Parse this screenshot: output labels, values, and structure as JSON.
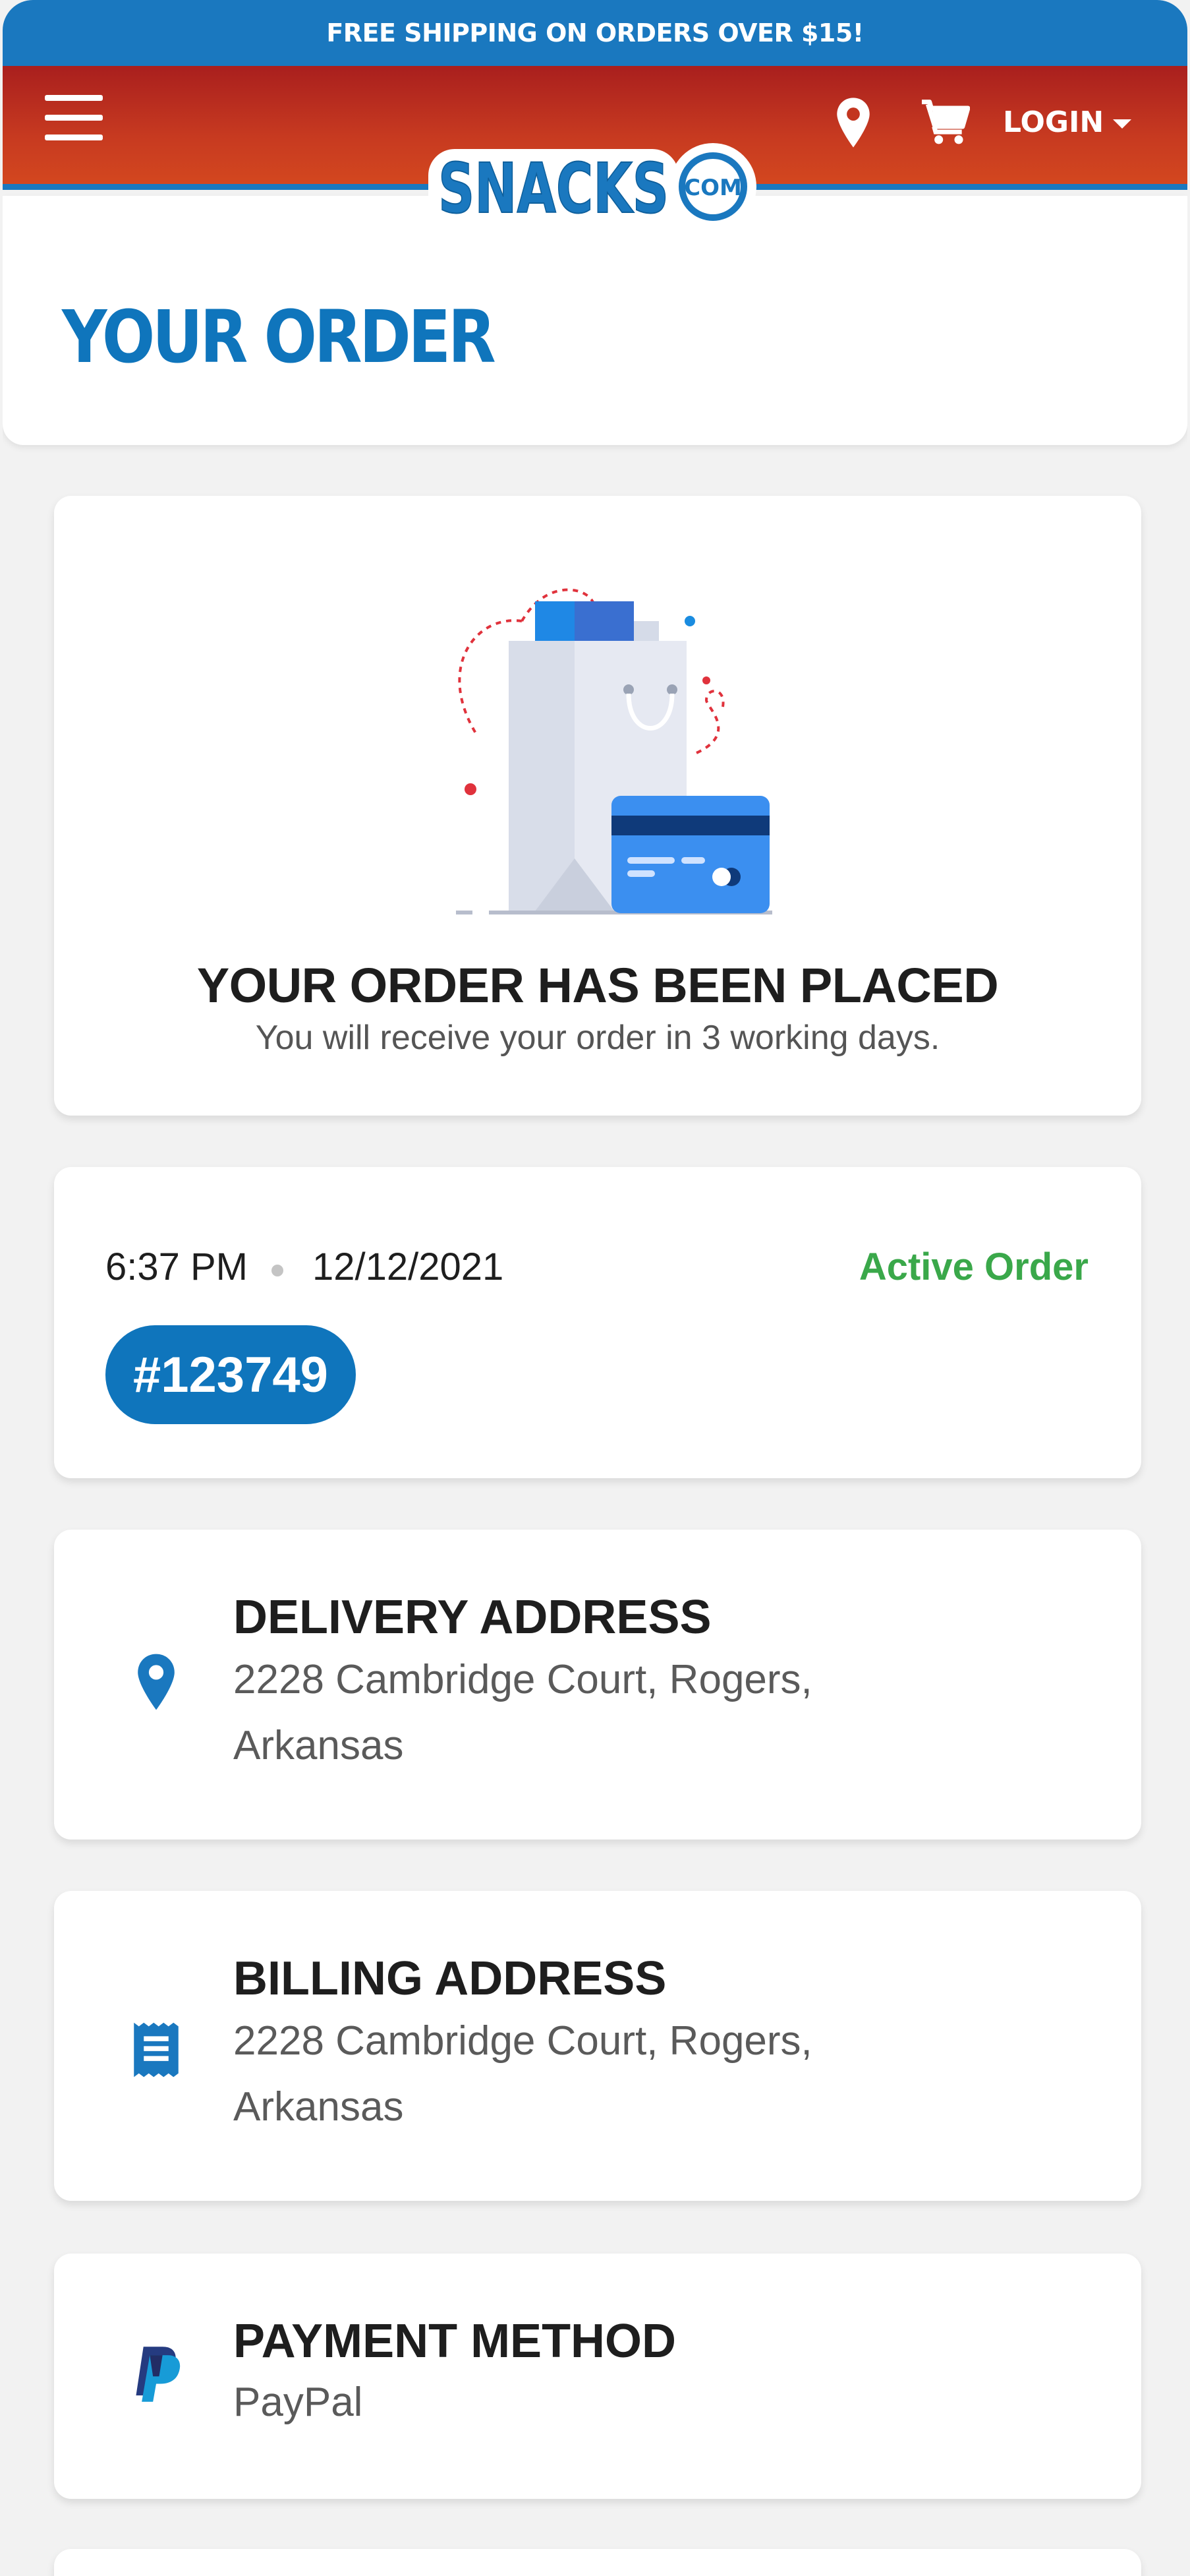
{
  "promo": {
    "text": "FREE SHIPPING ON ORDERS OVER $15!"
  },
  "header": {
    "menu_icon": "hamburger-menu-icon",
    "location_icon": "map-pin-icon",
    "cart_icon": "shopping-cart-icon",
    "login_label": "LOGIN",
    "logo_text": "SNACKS",
    "logo_badge": "COM",
    "colors": {
      "header_red": "#c73a20",
      "brand_blue": "#0f75bc"
    }
  },
  "page": {
    "title": "YOUR ORDER"
  },
  "placed": {
    "title": "YOUR ORDER HAS BEEN PLACED",
    "subtitle": "You will receive your order in 3 working days.",
    "illustration": "shopping-bag-and-credit-card-icon"
  },
  "order": {
    "time": "6:37 PM",
    "date": "12/12/2021",
    "status": "Active Order",
    "number": "#123749",
    "status_color": "#3aa84a"
  },
  "delivery": {
    "title": "DELIVERY ADDRESS",
    "address_line1": "2228 Cambridge Court, Rogers,",
    "address_line2": "Arkansas",
    "icon": "map-pin-icon"
  },
  "billing": {
    "title": "BILLING ADDRESS",
    "address_line1": "2228 Cambridge Court, Rogers,",
    "address_line2": "Arkansas",
    "icon": "receipt-icon"
  },
  "payment": {
    "title": "PAYMENT METHOD",
    "method": "PayPal",
    "icon": "paypal-icon"
  }
}
